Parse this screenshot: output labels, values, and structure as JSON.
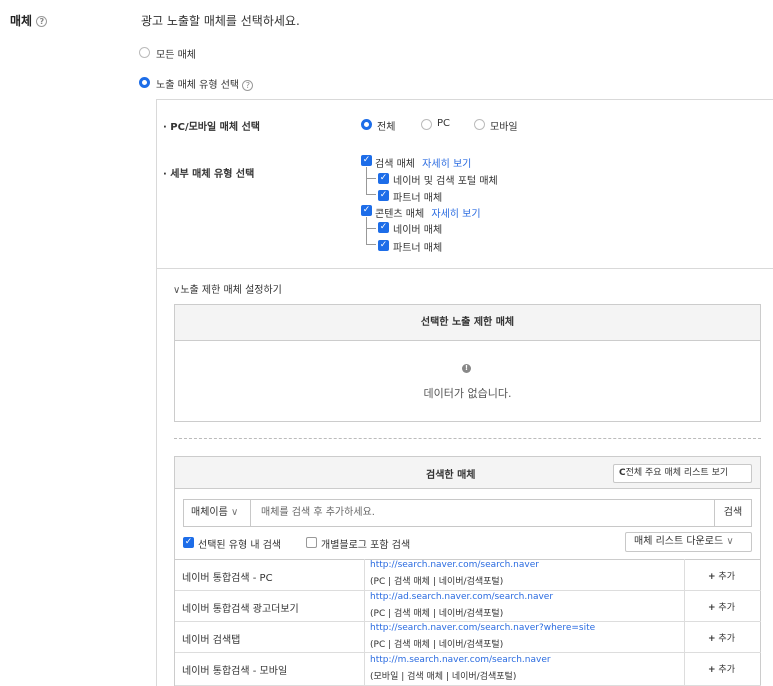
{
  "field": {
    "label": "매체",
    "help": "?",
    "description": "광고 노출할 매체를 선택하세요."
  },
  "media_options": [
    {
      "label": "모든 매체",
      "selected": false
    },
    {
      "label": "노출 매체 유형 선택",
      "selected": true
    }
  ],
  "device": {
    "title": "PC/모바일 매체 선택",
    "options": [
      {
        "label": "전체",
        "selected": true
      },
      {
        "label": "PC",
        "selected": false
      },
      {
        "label": "모바일",
        "selected": false
      }
    ]
  },
  "detail": {
    "title": "세부 매체 유형 선택",
    "search": {
      "label": "검색 매체",
      "link": "자세히 보기",
      "children": [
        "네이버 및 검색 포털 매체",
        "파트너 매체"
      ]
    },
    "content": {
      "label": "콘텐츠 매체",
      "link": "자세히 보기",
      "children": [
        "네이버 매체",
        "파트너 매체"
      ]
    }
  },
  "exclude": {
    "toggle": "노출 제한 매체 설정하기",
    "selected_title": "선택한 노출 제한 매체",
    "empty_icon": "!",
    "empty_text": "데이터가 없습니다."
  },
  "search_panel": {
    "title": "검색한 매체",
    "view_all": "전체 주요 매체 리스트 보기",
    "select_value": "매체이름",
    "search_placeholder": "매체를 검색 후 추가하세요.",
    "search_button": "검색",
    "check1": "선택된 유형 내 검색",
    "check2": "개별블로그 포함 검색",
    "download": "매체 리스트 다운로드",
    "add_label": "추가",
    "rows": [
      {
        "name": "네이버 통합검색 - PC",
        "url": "http://search.naver.com/search.naver",
        "meta": "(PC | 검색 매체 | 네이버/검색포털)"
      },
      {
        "name": "네이버 통합검색 광고더보기",
        "url": "http://ad.search.naver.com/search.naver",
        "meta": "(PC | 검색 매체 | 네이버/검색포털)"
      },
      {
        "name": "네이버 검색탭",
        "url": "http://search.naver.com/search.naver?where=site",
        "meta": "(PC | 검색 매체 | 네이버/검색포털)"
      },
      {
        "name": "네이버 통합검색 - 모바일",
        "url": "http://m.search.naver.com/search.naver",
        "meta": "(모바일 | 검색 매체 | 네이버/검색포털)"
      }
    ]
  }
}
